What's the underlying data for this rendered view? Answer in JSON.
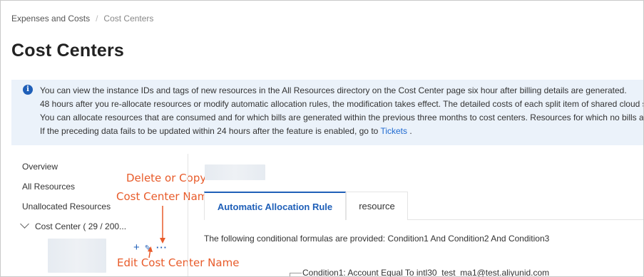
{
  "breadcrumb": {
    "root": "Expenses and Costs",
    "current": "Cost Centers"
  },
  "page_title": "Cost Centers",
  "notice": {
    "lines": [
      "You can view the instance IDs and tags of new resources in the All Resources directory on the Cost Center page six hour after billing details are generated.",
      "48 hours after you re-allocate resources or modify automatic allocation rules, the modification takes effect. The detailed costs of each split item of shared cloud s",
      "You can allocate resources that are consumed and for which bills are generated within the previous three months to cost centers. Resources for which no bills are"
    ],
    "last_line_prefix": "If the preceding data fails to be updated within 24 hours after the feature is enabled, go to ",
    "link": "Tickets",
    "last_line_suffix": "."
  },
  "sidebar": {
    "items": [
      "Overview",
      "All Resources",
      "Unallocated Resources"
    ],
    "tree_root": "Cost Center ( 29 / 200..."
  },
  "node_actions": {
    "add": "+",
    "edit": "✎",
    "more": "···"
  },
  "annotations": {
    "delete_copy": [
      "Delete or Copy",
      "Cost Center Name"
    ],
    "edit": "Edit Cost Center Name"
  },
  "tabs": [
    "Automatic Allocation Rule",
    "resource"
  ],
  "formula": "The following conditional formulas are provided: Condition1 And Condition2 And Condition3",
  "condition1": "Condition1:  Account  Equal To  intl30_test_ma1@test.aliyunid.com",
  "colors": {
    "accent": "#1f5fb8",
    "annotation": "#e85b2a",
    "notice_bg": "#ebf2fa"
  }
}
